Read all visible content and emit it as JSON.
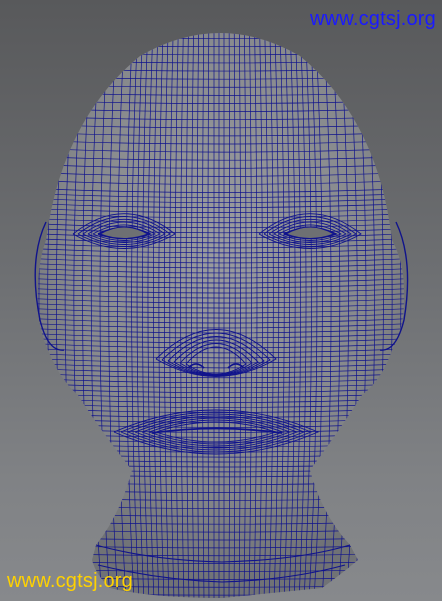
{
  "watermarks": {
    "top": "www.cgtsj.org",
    "bottom": "www.cgtsj.org"
  },
  "colors": {
    "wire": "#10138c",
    "watermark_top": "#1a1aff",
    "watermark_bottom": "#ffd200",
    "mesh_fill": "#8a8c8f"
  },
  "icons": {
    "head_model": "wireframe-head-mesh"
  }
}
